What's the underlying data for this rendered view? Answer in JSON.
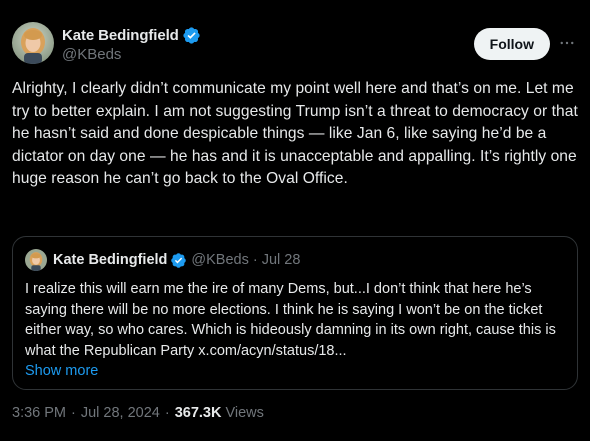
{
  "author": {
    "display_name": "Kate Bedingfield",
    "handle": "@KBeds",
    "verified": true
  },
  "follow_button": {
    "label": "Follow"
  },
  "more_icon": "more-horizontal-icon",
  "tweet": {
    "text": "Alrighty, I clearly didn’t communicate my point well here and that’s on me. Let me try to better explain. I am not suggesting Trump isn’t a threat to democracy or that he hasn’t said and done despicable things — like Jan 6, like saying he’d be a dictator on day one — he has and it is unacceptable and appalling. It’s rightly one huge reason he can’t go back to the Oval Office."
  },
  "quoted_tweet": {
    "display_name": "Kate Bedingfield",
    "handle": "@KBeds",
    "separator": "·",
    "date": "Jul 28",
    "text": "I realize this will earn me the ire of many Dems, but...I don’t think that here he’s saying there will be no more elections. I think he is saying I won’t be on the ticket either way, so who cares. Which is hideously damning in its own right, cause this is what the Republican Party x.com/acyn/status/18...",
    "show_more_label": "Show more"
  },
  "meta": {
    "time": "3:36 PM",
    "separator": "·",
    "date": "Jul 28, 2024",
    "views_count": "367.3K",
    "views_label": "Views"
  },
  "colors": {
    "background": "#000000",
    "text_primary": "#e7e9ea",
    "text_secondary": "#71767b",
    "accent": "#1d9bf0",
    "border": "#2f3336",
    "button_bg": "#eff3f4"
  }
}
